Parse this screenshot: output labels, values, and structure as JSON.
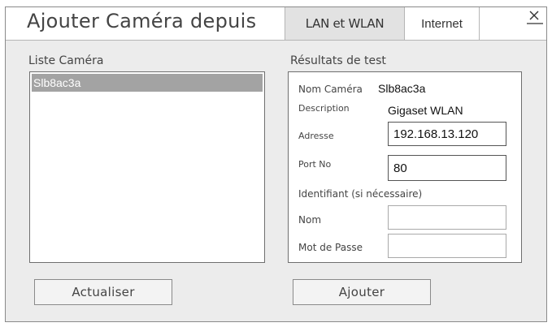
{
  "dialog": {
    "title": "Ajouter Caméra depuis",
    "tabs": [
      {
        "label": "LAN et WLAN",
        "active": true
      },
      {
        "label": "Internet",
        "active": false
      }
    ],
    "close_icon": "close-icon"
  },
  "camera_list": {
    "label": "Liste Caméra",
    "items": [
      "Slb8ac3a"
    ],
    "selected_index": 0
  },
  "results": {
    "label": "Résultats de test",
    "camera_name_label": "Nom Caméra",
    "camera_name_value": "Slb8ac3a",
    "description_label": "Description",
    "description_value": "Gigaset WLAN",
    "address_label": "Adresse",
    "address_value": "192.168.13.120",
    "port_label": "Port No",
    "port_value": "80",
    "credentials_label": "Identifiant (si nécessaire)",
    "name_label": "Nom",
    "name_value": "",
    "password_label": "Mot de Passe",
    "password_value": ""
  },
  "buttons": {
    "refresh": "Actualiser",
    "add": "Ajouter"
  },
  "colors": {
    "selected_item_bg": "#a3a3a3",
    "active_tab_bg": "#e2e2e2",
    "dialog_bg": "#ececec"
  }
}
